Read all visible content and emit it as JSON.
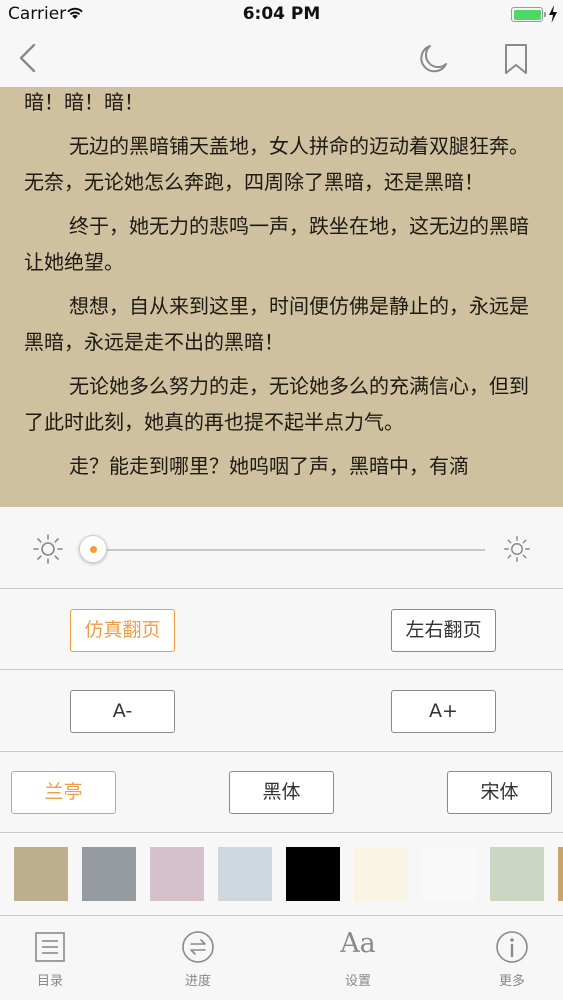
{
  "status_bar": {
    "carrier": "Carrier",
    "time": "6:04 PM"
  },
  "nav": {
    "back_icon": "chevron-left-icon",
    "night_icon": "moon-icon",
    "bookmark_icon": "bookmark-icon"
  },
  "reading": {
    "background_color": "#cfc1a0",
    "paragraphs": [
      "暗！暗！暗！",
      "无边的黑暗铺天盖地，女人拼命的迈动着双腿狂奔。无奈，无论她怎么奔跑，四周除了黑暗，还是黑暗！",
      "终于，她无力的悲鸣一声，跌坐在地，这无边的黑暗让她绝望。",
      "想想，自从来到这里，时间便仿佛是静止的，永远是黑暗，永远是走不出的黑暗！",
      "无论她多么努力的走，无论她多么的充满信心，但到了此时此刻，她真的再也提不起半点力气。",
      "走？能走到哪里？她呜咽了声，黑暗中，有滴"
    ]
  },
  "brightness": {
    "level": 0.0,
    "accent_color": "#f39c32"
  },
  "page_turn": {
    "options": [
      "仿真翻页",
      "左右翻页"
    ],
    "selected": "仿真翻页"
  },
  "font_size": {
    "decrease_label": "A-",
    "increase_label": "A+"
  },
  "font_family": {
    "options": [
      "兰亭",
      "黑体",
      "宋体"
    ],
    "selected": "兰亭"
  },
  "theme_colors": [
    "#bcb08e",
    "#959ba1",
    "#d6c0cb",
    "#d0d8df",
    "#000000",
    "#f8f3e3",
    "#f9f9f9",
    "#cdd6c3",
    "#c9a46e"
  ],
  "tabs": [
    {
      "label": "目录",
      "icon": "list-icon"
    },
    {
      "label": "进度",
      "icon": "progress-icon"
    },
    {
      "label": "设置",
      "icon": "font-settings-icon"
    },
    {
      "label": "更多",
      "icon": "info-icon"
    }
  ]
}
